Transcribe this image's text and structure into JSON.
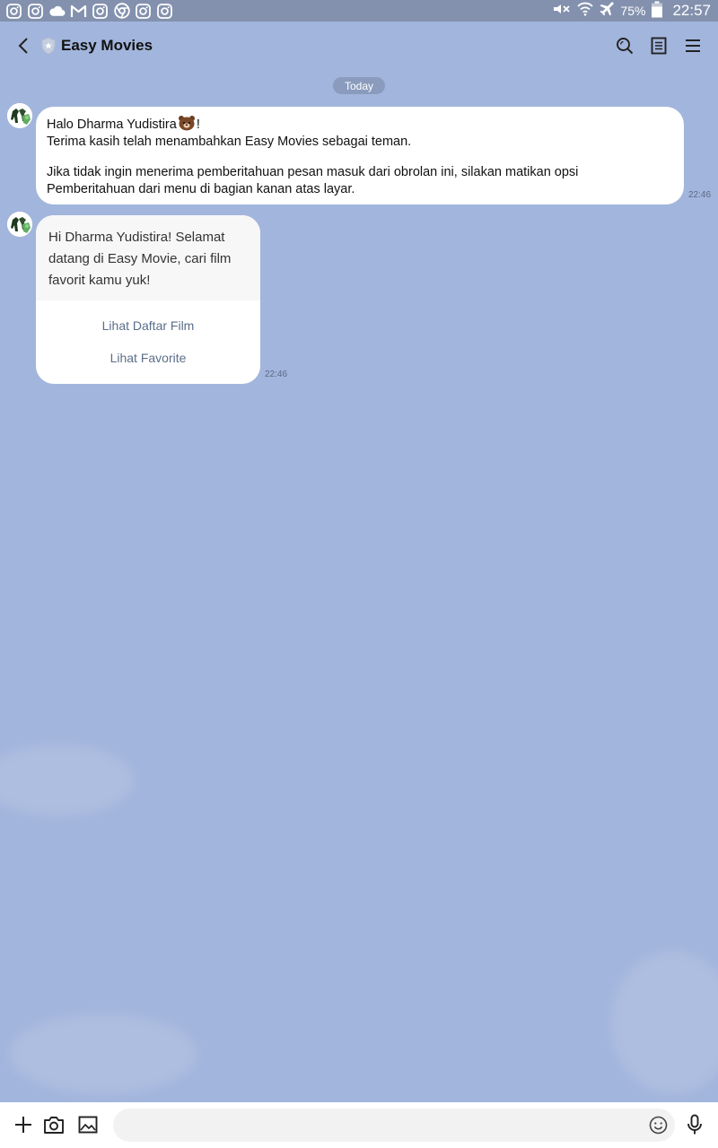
{
  "status_bar": {
    "notification_icons": [
      "instagram-icon",
      "instagram-icon",
      "cloud-icon",
      "gmail-icon",
      "instagram-icon",
      "chrome-icon",
      "instagram-icon",
      "instagram-icon"
    ],
    "battery_percent": "75%",
    "time": "22:57"
  },
  "header": {
    "title": "Easy Movies"
  },
  "chat": {
    "date_label": "Today",
    "messages": [
      {
        "line1": "Halo Dharma Yudistira",
        "line1_suffix": "!",
        "line2": "Terima kasih telah menambahkan Easy Movies sebagai teman.",
        "line3": "Jika tidak ingin menerima pemberitahuan pesan masuk dari obrolan ini, silakan matikan opsi",
        "line4": "Pemberitahuan dari menu di bagian kanan atas layar.",
        "time": "22:46"
      },
      {
        "text": "Hi Dharma Yudistira! Selamat datang di Easy Movie, cari film favorit kamu yuk!",
        "actions": [
          "Lihat Daftar Film",
          "Lihat Favorite"
        ],
        "time": "22:46"
      }
    ]
  },
  "input_bar": {
    "placeholder": ""
  },
  "colors": {
    "background": "#a2b5dc",
    "status_bar": "#8391ae",
    "bubble": "#ffffff",
    "action_text": "#5b6e8a"
  }
}
